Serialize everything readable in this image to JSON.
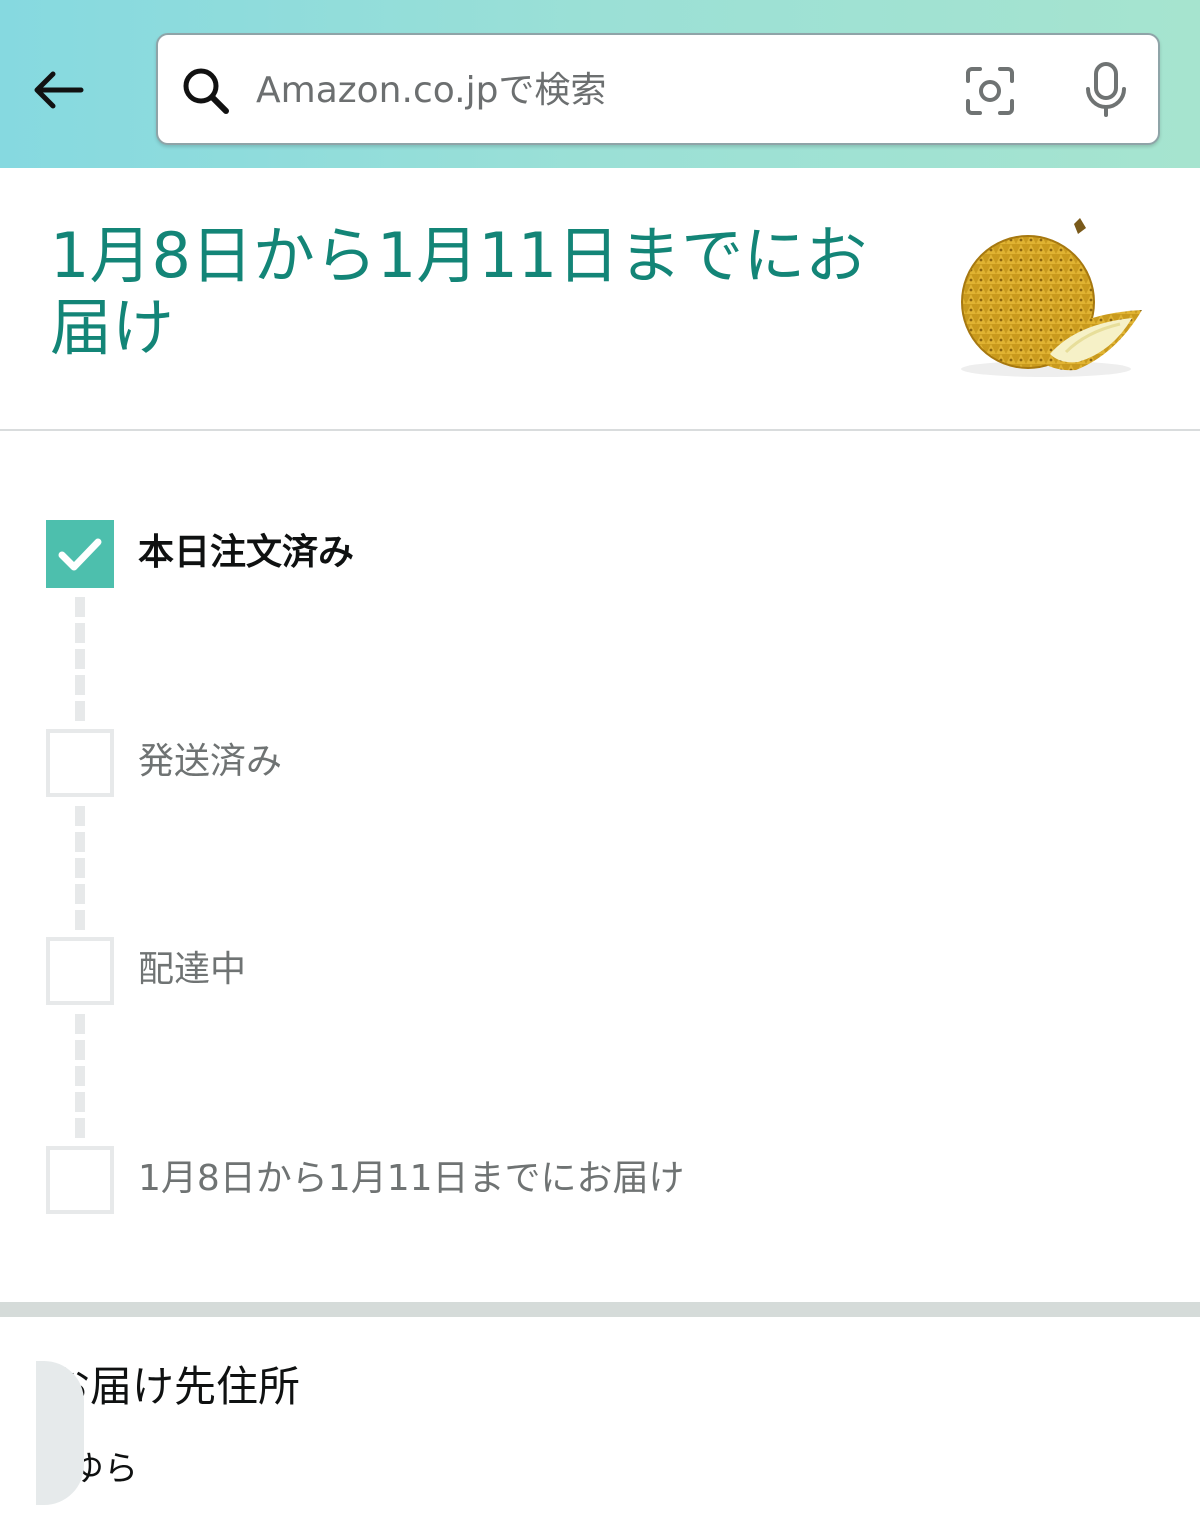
{
  "header": {
    "back_label": "",
    "search": {
      "placeholder": "Amazon.co.jpで検索",
      "value": ""
    },
    "icons": [
      "back-arrow-icon",
      "search-icon",
      "camera-icon",
      "microphone-icon"
    ]
  },
  "delivery": {
    "title": "1月8日から1月11日までにお届け"
  },
  "tracker": {
    "steps": [
      {
        "label": "本日注文済み",
        "done": true
      },
      {
        "label": "発送済み",
        "done": false
      },
      {
        "label": "配達中",
        "done": false
      },
      {
        "label": "1月8日から1月11日までにお届け",
        "done": false
      }
    ]
  },
  "address": {
    "title": "お届け先住所",
    "name": "ゆら"
  },
  "colors": {
    "accent_teal": "#138577",
    "check_fill": "#4dbfad",
    "header_gradient_start": "#86d9e0",
    "header_gradient_end": "#a6e4cf"
  }
}
